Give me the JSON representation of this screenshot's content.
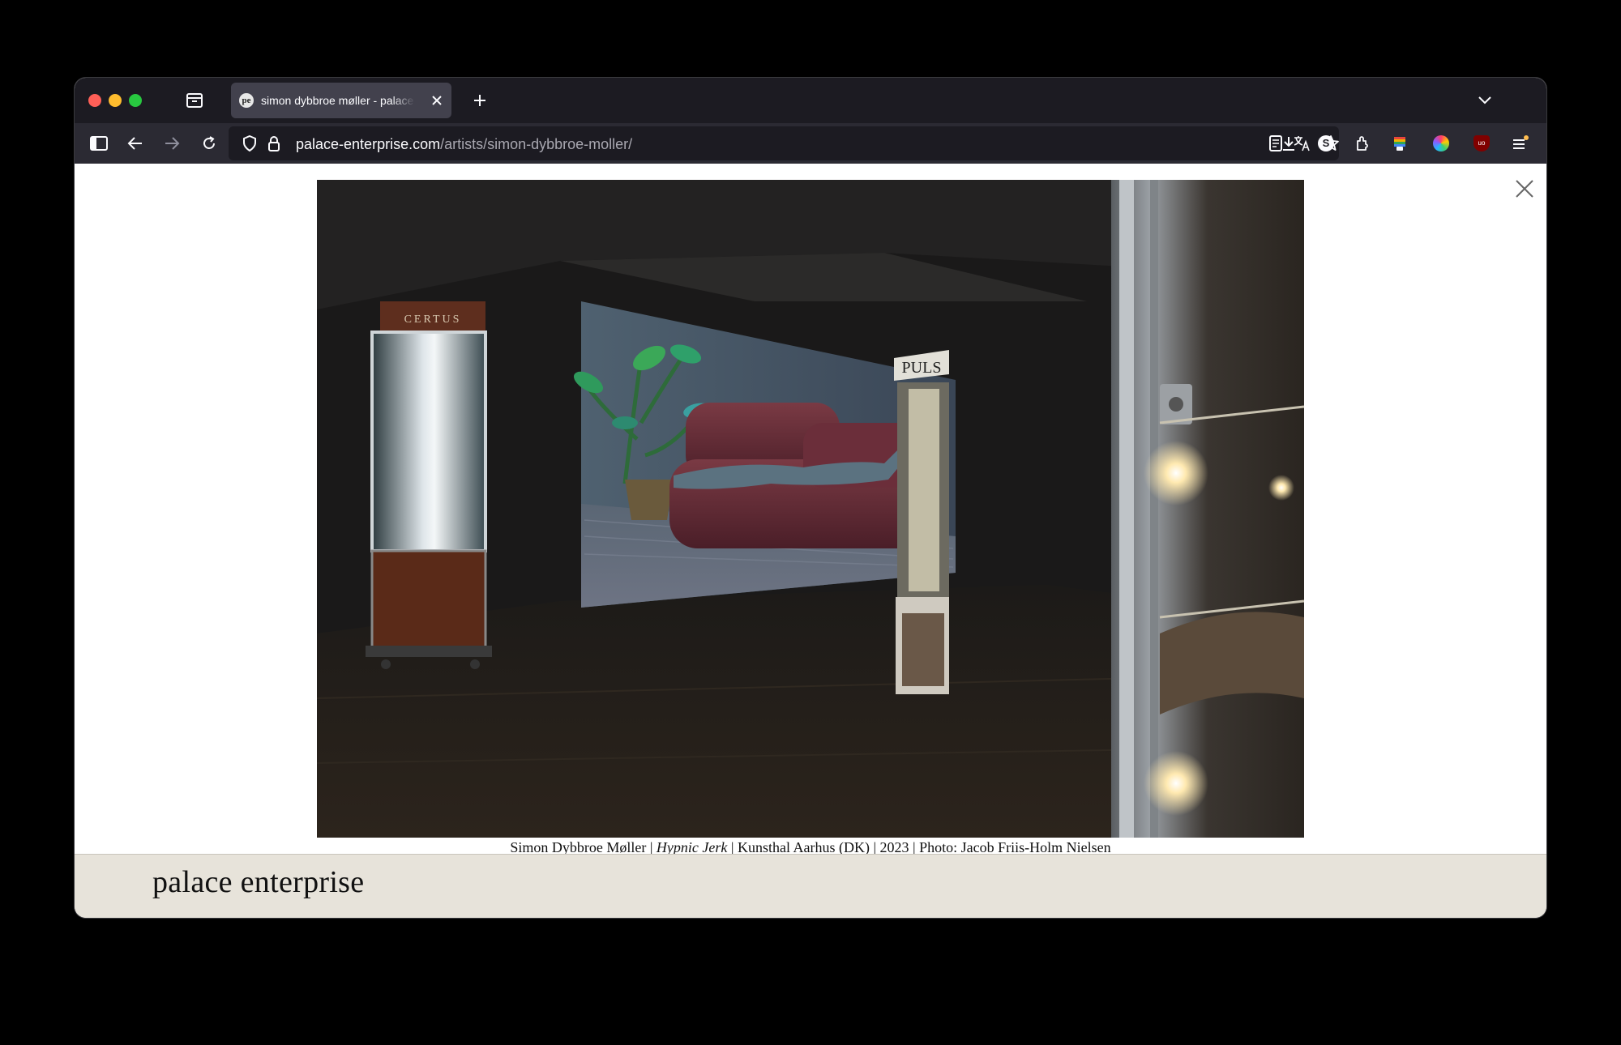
{
  "browser": {
    "tab": {
      "favicon_text": "pe",
      "title": "simon dybbroe møller - palace enterprise"
    },
    "url": {
      "domain": "palace-enterprise.com",
      "path": "/artists/simon-dybbroe-moller/"
    },
    "icons": [
      "sidebar-icon",
      "back-icon",
      "forward-icon",
      "reload-icon",
      "shield-icon",
      "lock-icon",
      "reader-view-icon",
      "translate-icon",
      "bookmark-star-icon",
      "download-icon",
      "extension-s-icon",
      "extensions-icon",
      "rainbow-extension-icon",
      "color-wheel-extension-icon",
      "ublock-icon",
      "menu-icon"
    ],
    "extension_s_label": "S",
    "ublock_label": "uo"
  },
  "gallery": {
    "photo_signs": {
      "left_vitrine": "CERTUS",
      "right_vitrine": "PULS"
    },
    "caption": {
      "artist": "Simon Dybbroe Møller | ",
      "work": "Hypnic Jerk",
      "details": " | Kunsthal Aarhus (DK) | 2023 | Photo: Jacob Friis-Holm Nielsen"
    }
  },
  "footer": {
    "brand": "palace enterprise"
  },
  "colors": {
    "window_bg": "#000000",
    "tabbar_bg": "#1c1b22",
    "toolbar_bg": "#2b2a33",
    "active_tab_bg": "#42414d",
    "footer_bg": "#e7e3da"
  }
}
